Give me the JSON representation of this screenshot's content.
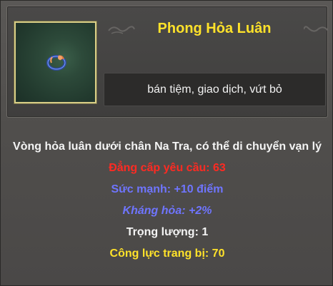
{
  "item": {
    "name": "Phong Hỏa Luân",
    "icon": "fire-wheel-icon",
    "trade_options": "bán tiệm,  giao dịch,  vứt bỏ",
    "description": "Vòng hỏa luân dưới chân Na Tra, có thể di chuyển vạn lý",
    "level_requirement": "Đẳng cấp yêu cầu: 63",
    "strength": "Sức mạnh: +10 điểm",
    "fire_resistance": "Kháng hỏa: +2%",
    "weight": "Trọng lượng: 1",
    "equip_power": "Công lực trang bị: 70"
  },
  "colors": {
    "title": "#ffe22a",
    "requirement": "#ff2a22",
    "bonus": "#6f75ff",
    "frame": "#d9cf86"
  }
}
